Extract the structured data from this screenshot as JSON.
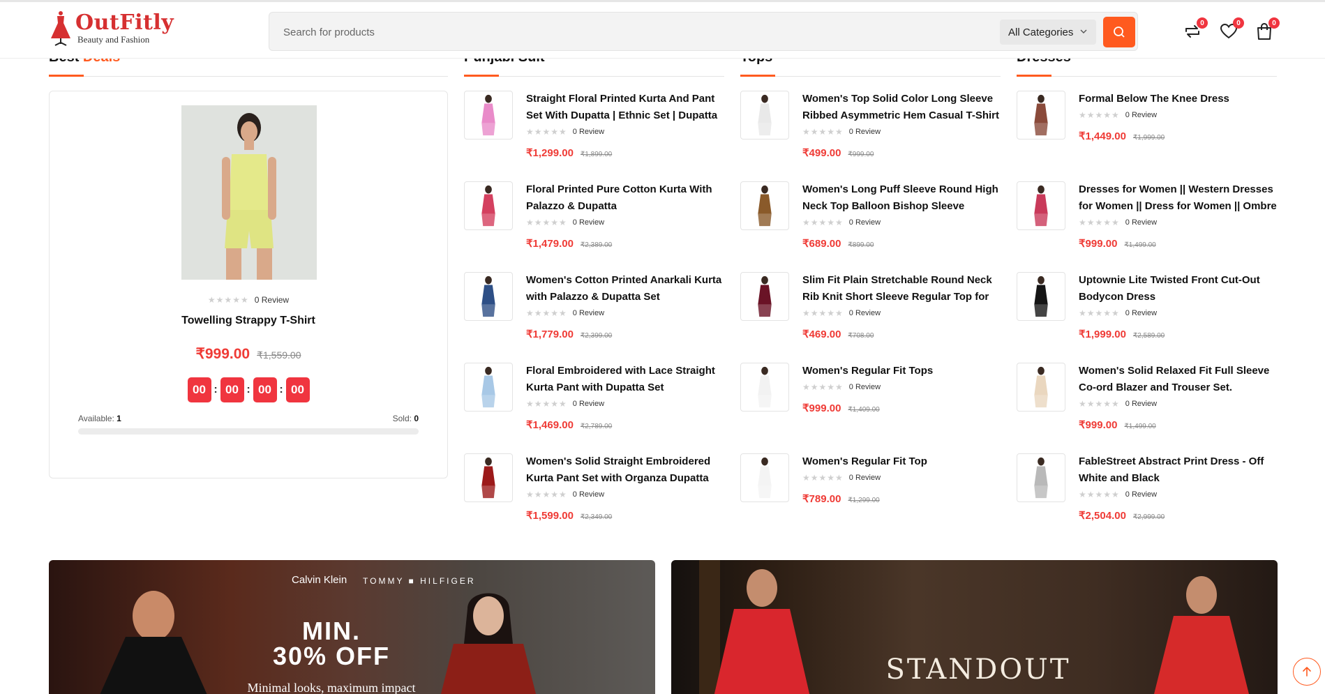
{
  "header": {
    "logo_title": "OutFitly",
    "logo_subtitle": "Beauty and Fashion",
    "search_placeholder": "Search for products",
    "category_selected": "All Categories",
    "compare_count": "0",
    "wishlist_count": "0",
    "cart_count": "0"
  },
  "colors": {
    "accent": "#ff5a1f",
    "price": "#ef3b36",
    "badge": "#f0353f"
  },
  "sections": {
    "best_deals_prefix": "Best",
    "best_deals_accent": "Deals",
    "punjabi": "Punjabi Suit",
    "tops": "Tops",
    "dresses": "Dresses"
  },
  "deal": {
    "reviews": "0 Review",
    "name": "Towelling Strappy T-Shirt",
    "price": "₹999.00",
    "old_price": "₹1,559.00",
    "timer": [
      "00",
      "00",
      "00",
      "00"
    ],
    "available_label": "Available:",
    "available_value": "1",
    "sold_label": "Sold:",
    "sold_value": "0",
    "sold_fraction": 0
  },
  "punjabi_items": [
    {
      "title": "Straight Floral Printed Kurta And Pant Set With Dupatta | Ethnic Set | Dupatta Set",
      "reviews": "0 Review",
      "price": "₹1,299.00",
      "old": "₹1,899.00",
      "color": "#e98bc9"
    },
    {
      "title": "Floral Printed Pure Cotton Kurta With Palazzo & Dupatta",
      "reviews": "0 Review",
      "price": "₹1,479.00",
      "old": "₹2,389.00",
      "color": "#d4405f"
    },
    {
      "title": "Women's Cotton Printed Anarkali Kurta with Palazzo & Dupatta Set",
      "reviews": "0 Review",
      "price": "₹1,779.00",
      "old": "₹2,399.00",
      "color": "#2e4f86"
    },
    {
      "title": "Floral Embroidered with Lace Straight Kurta Pant with Dupatta Set",
      "reviews": "0 Review",
      "price": "₹1,469.00",
      "old": "₹2,789.00",
      "color": "#a8c8e6"
    },
    {
      "title": "Women's Solid Straight Embroidered Kurta Pant Set with Organza Dupatta",
      "reviews": "0 Review",
      "price": "₹1,599.00",
      "old": "₹2,349.00",
      "color": "#9c1a1a"
    }
  ],
  "tops_items": [
    {
      "title": "Women's Top Solid Color Long Sleeve Ribbed Asymmetric Hem Casual T-Shirt",
      "reviews": "0 Review",
      "price": "₹499.00",
      "old": "₹999.00",
      "color": "#e9e9e9"
    },
    {
      "title": "Women's Long Puff Sleeve Round High Neck Top Balloon Bishop Sleeve Blouse",
      "reviews": "0 Review",
      "price": "₹689.00",
      "old": "₹899.00",
      "color": "#8a5a2a"
    },
    {
      "title": "Slim Fit Plain Stretchable Round Neck Rib Knit Short Sleeve Regular Top for Women",
      "reviews": "0 Review",
      "price": "₹469.00",
      "old": "₹708.00",
      "color": "#6a1326"
    },
    {
      "title": "Women's Regular Fit Tops",
      "reviews": "0 Review",
      "price": "₹999.00",
      "old": "₹1,409.00",
      "color": "#f2f2f2"
    },
    {
      "title": "Women's Regular Fit Top",
      "reviews": "0 Review",
      "price": "₹789.00",
      "old": "₹1,299.00",
      "color": "#f4f4f4"
    }
  ],
  "dress_items": [
    {
      "title": "Formal Below The Knee Dress",
      "reviews": "0 Review",
      "price": "₹1,449.00",
      "old": "₹1,999.00",
      "color": "#8a4a3a"
    },
    {
      "title": "Dresses for Women || Western Dresses for Women || Dress for Women || Ombre Dress",
      "reviews": "0 Review",
      "price": "₹999.00",
      "old": "₹1,499.00",
      "color": "#c93a5a"
    },
    {
      "title": "Uptownie Lite Twisted Front Cut-Out Bodycon Dress",
      "reviews": "0 Review",
      "price": "₹1,999.00",
      "old": "₹2,589.00",
      "color": "#151515"
    },
    {
      "title": "Women's Solid Relaxed Fit Full Sleeve Co-ord Blazer and Trouser Set.",
      "reviews": "0 Review",
      "price": "₹999.00",
      "old": "₹1,499.00",
      "color": "#ead7bf"
    },
    {
      "title": "FableStreet Abstract Print Dress - Off White and Black",
      "reviews": "0 Review",
      "price": "₹2,504.00",
      "old": "₹2,999.00",
      "color": "#b9b9b9"
    }
  ],
  "banners": {
    "left_brand_1": "Calvin Klein",
    "left_brand_2": "TOMMY ■ HILFIGER",
    "left_headline_1": "MIN.",
    "left_headline_2": "30% OFF",
    "left_sub": "Minimal looks, maximum impact",
    "right_headline": "STANDOUT"
  },
  "icons": {
    "compare": "compare-arrows-icon",
    "wishlist": "heart-icon",
    "cart": "shopping-bag-icon",
    "search": "search-icon",
    "scroll_top": "arrow-up-icon"
  }
}
